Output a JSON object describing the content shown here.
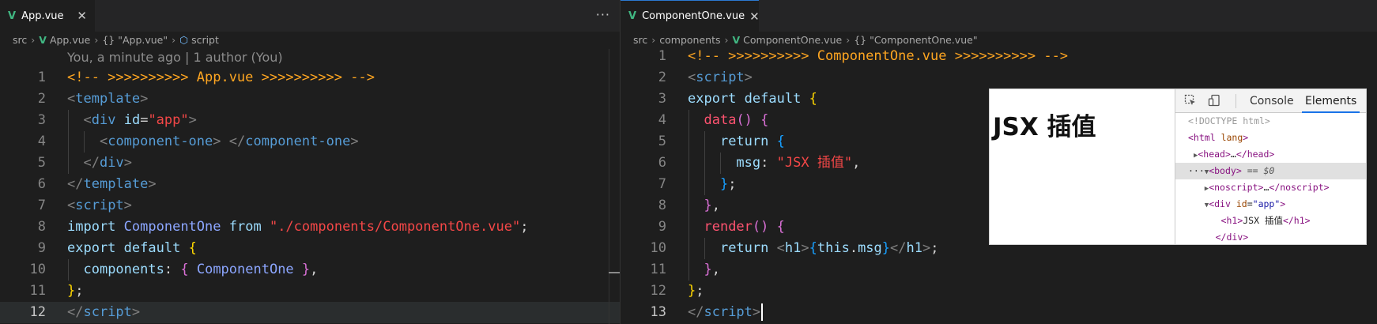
{
  "left_editor": {
    "tab": {
      "icon": "vue-file-icon",
      "label": "App.vue",
      "close": "✕"
    },
    "more_actions": "···",
    "breadcrumb": [
      "src",
      "App.vue",
      "{} \"App.vue\"",
      "script"
    ],
    "blame": "You, a minute ago | 1 author (You)",
    "lines": [
      {
        "n": "1",
        "html": "<span class=\"cm\">&lt;!-- &gt;&gt;&gt;&gt;&gt;&gt;&gt;&gt;&gt;&gt; App.vue &gt;&gt;&gt;&gt;&gt;&gt;&gt;&gt;&gt;&gt; --&gt;</span>"
      },
      {
        "n": "2",
        "html": "<span class=\"pt\">&lt;</span><span class=\"tg\">template</span><span class=\"pt\">&gt;</span>"
      },
      {
        "n": "3",
        "html": "  <span class=\"pt\">&lt;</span><span class=\"tg\">div</span> <span class=\"at\">id</span><span class=\"wh\">=</span><span class=\"st\">\"app\"</span><span class=\"pt\">&gt;</span>"
      },
      {
        "n": "4",
        "html": "    <span class=\"pt\">&lt;</span><span class=\"tg\">component-one</span><span class=\"pt\">&gt;</span> <span class=\"pt\">&lt;/</span><span class=\"tg\">component-one</span><span class=\"pt\">&gt;</span>"
      },
      {
        "n": "5",
        "html": "  <span class=\"pt\">&lt;/</span><span class=\"tg\">div</span><span class=\"pt\">&gt;</span>"
      },
      {
        "n": "6",
        "html": "<span class=\"pt\">&lt;/</span><span class=\"tg\">template</span><span class=\"pt\">&gt;</span>"
      },
      {
        "n": "7",
        "html": "<span class=\"pt\">&lt;</span><span class=\"tg\">script</span><span class=\"pt\">&gt;</span>"
      },
      {
        "n": "8",
        "html": "<span class=\"at\">import</span> <span class=\"cl2\">ComponentOne</span> <span class=\"at\">from</span> <span class=\"st\">\"./components/ComponentOne.vue\"</span><span class=\"wh\">;</span>"
      },
      {
        "n": "9",
        "html": "<span class=\"at\">export</span> <span class=\"at\">default</span> <span class=\"br1\">{</span>"
      },
      {
        "n": "10",
        "html": "  <span class=\"ky\">components</span><span class=\"wh\">:</span> <span class=\"br2\">{</span> <span class=\"cl2\">ComponentOne</span> <span class=\"br2\">}</span><span class=\"wh\">,</span>"
      },
      {
        "n": "11",
        "html": "<span class=\"br1\">}</span><span class=\"wh\">;</span>"
      },
      {
        "n": "12",
        "html": "<span class=\"pt\">&lt;/</span><span class=\"tg\">script</span><span class=\"pt\">&gt;</span>"
      }
    ],
    "active_line": "12"
  },
  "right_editor": {
    "tab": {
      "icon": "vue-file-icon",
      "label": "ComponentOne.vue",
      "close": "✕"
    },
    "breadcrumb": [
      "src",
      "components",
      "ComponentOne.vue",
      "{} \"ComponentOne.vue\""
    ],
    "lines": [
      {
        "n": "1",
        "html": "<span class=\"cm\">&lt;!-- &gt;&gt;&gt;&gt;&gt;&gt;&gt;&gt;&gt;&gt; ComponentOne.vue &gt;&gt;&gt;&gt;&gt;&gt;&gt;&gt;&gt;&gt; --&gt;</span>"
      },
      {
        "n": "2",
        "html": "<span class=\"pt\">&lt;</span><span class=\"tg\">script</span><span class=\"pt\">&gt;</span>"
      },
      {
        "n": "3",
        "html": "<span class=\"at\">export</span> <span class=\"at\">default</span> <span class=\"br1\">{</span>"
      },
      {
        "n": "4",
        "html": "  <span class=\"fn\">data</span><span class=\"br2\">()</span> <span class=\"br2\">{</span>"
      },
      {
        "n": "5",
        "html": "    <span class=\"at\">return</span> <span class=\"br3\">{</span>"
      },
      {
        "n": "6",
        "html": "      <span class=\"ky\">msg</span><span class=\"wh\">:</span> <span class=\"st\">\"JSX 插值\"</span><span class=\"wh\">,</span>"
      },
      {
        "n": "7",
        "html": "    <span class=\"br3\">}</span><span class=\"wh\">;</span>"
      },
      {
        "n": "8",
        "html": "  <span class=\"br2\">}</span><span class=\"wh\">,</span>"
      },
      {
        "n": "9",
        "html": "  <span class=\"fn\">render</span><span class=\"br2\">()</span> <span class=\"br2\">{</span>"
      },
      {
        "n": "10",
        "html": "    <span class=\"at\">return</span> <span class=\"pt\">&lt;</span><span class=\"ky\">h1</span><span class=\"pt\">&gt;</span><span class=\"br3\">{</span><span class=\"ky\">this</span><span class=\"wh\">.</span><span class=\"ky\">msg</span><span class=\"br3\">}</span><span class=\"pt\">&lt;/</span><span class=\"ky\">h1</span><span class=\"pt\">&gt;</span><span class=\"wh\">;</span>"
      },
      {
        "n": "11",
        "html": "  <span class=\"br2\">}</span><span class=\"wh\">,</span>"
      },
      {
        "n": "12",
        "html": "<span class=\"br1\">}</span><span class=\"wh\">;</span>"
      },
      {
        "n": "13",
        "html": "<span class=\"pt\">&lt;/</span><span class=\"tg\">script</span><span class=\"pt\">&gt;</span>"
      }
    ],
    "current_line": "13"
  },
  "preview": {
    "heading": "JSX 插值",
    "devtools": {
      "tabs": [
        "Console",
        "Elements"
      ],
      "active_tab": "Elements",
      "dom": [
        {
          "html": "<span class=\"dc\">&lt;!DOCTYPE html&gt;</span>"
        },
        {
          "html": "<span class=\"dt\">&lt;html</span> <span class=\"da\">lang</span><span class=\"dt\">&gt;</span>"
        },
        {
          "html": " <span class=\"arrow\">▶</span><span class=\"dt\">&lt;head&gt;</span><span class=\"dx\">…</span><span class=\"dt\">&lt;/head&gt;</span>"
        },
        {
          "html": "<span class=\"dx\">···</span><span class=\"arrow\">▼</span><span class=\"dt\">&lt;body&gt;</span> <span class=\"dd\">== $0</span>",
          "selected": true
        },
        {
          "html": "   <span class=\"arrow\">▶</span><span class=\"dt\">&lt;noscript&gt;</span><span class=\"dx\">…</span><span class=\"dt\">&lt;/noscript&gt;</span>"
        },
        {
          "html": "   <span class=\"arrow\">▼</span><span class=\"dt\">&lt;div</span> <span class=\"da\">id</span><span class=\"dx\">=</span><span class=\"dv\">\"app\"</span><span class=\"dt\">&gt;</span>"
        },
        {
          "html": "      <span class=\"dt\">&lt;h1&gt;</span><span class=\"dx\">JSX 插值</span><span class=\"dt\">&lt;/h1&gt;</span>"
        },
        {
          "html": "     <span class=\"dt\">&lt;/div&gt;</span>"
        }
      ]
    }
  }
}
